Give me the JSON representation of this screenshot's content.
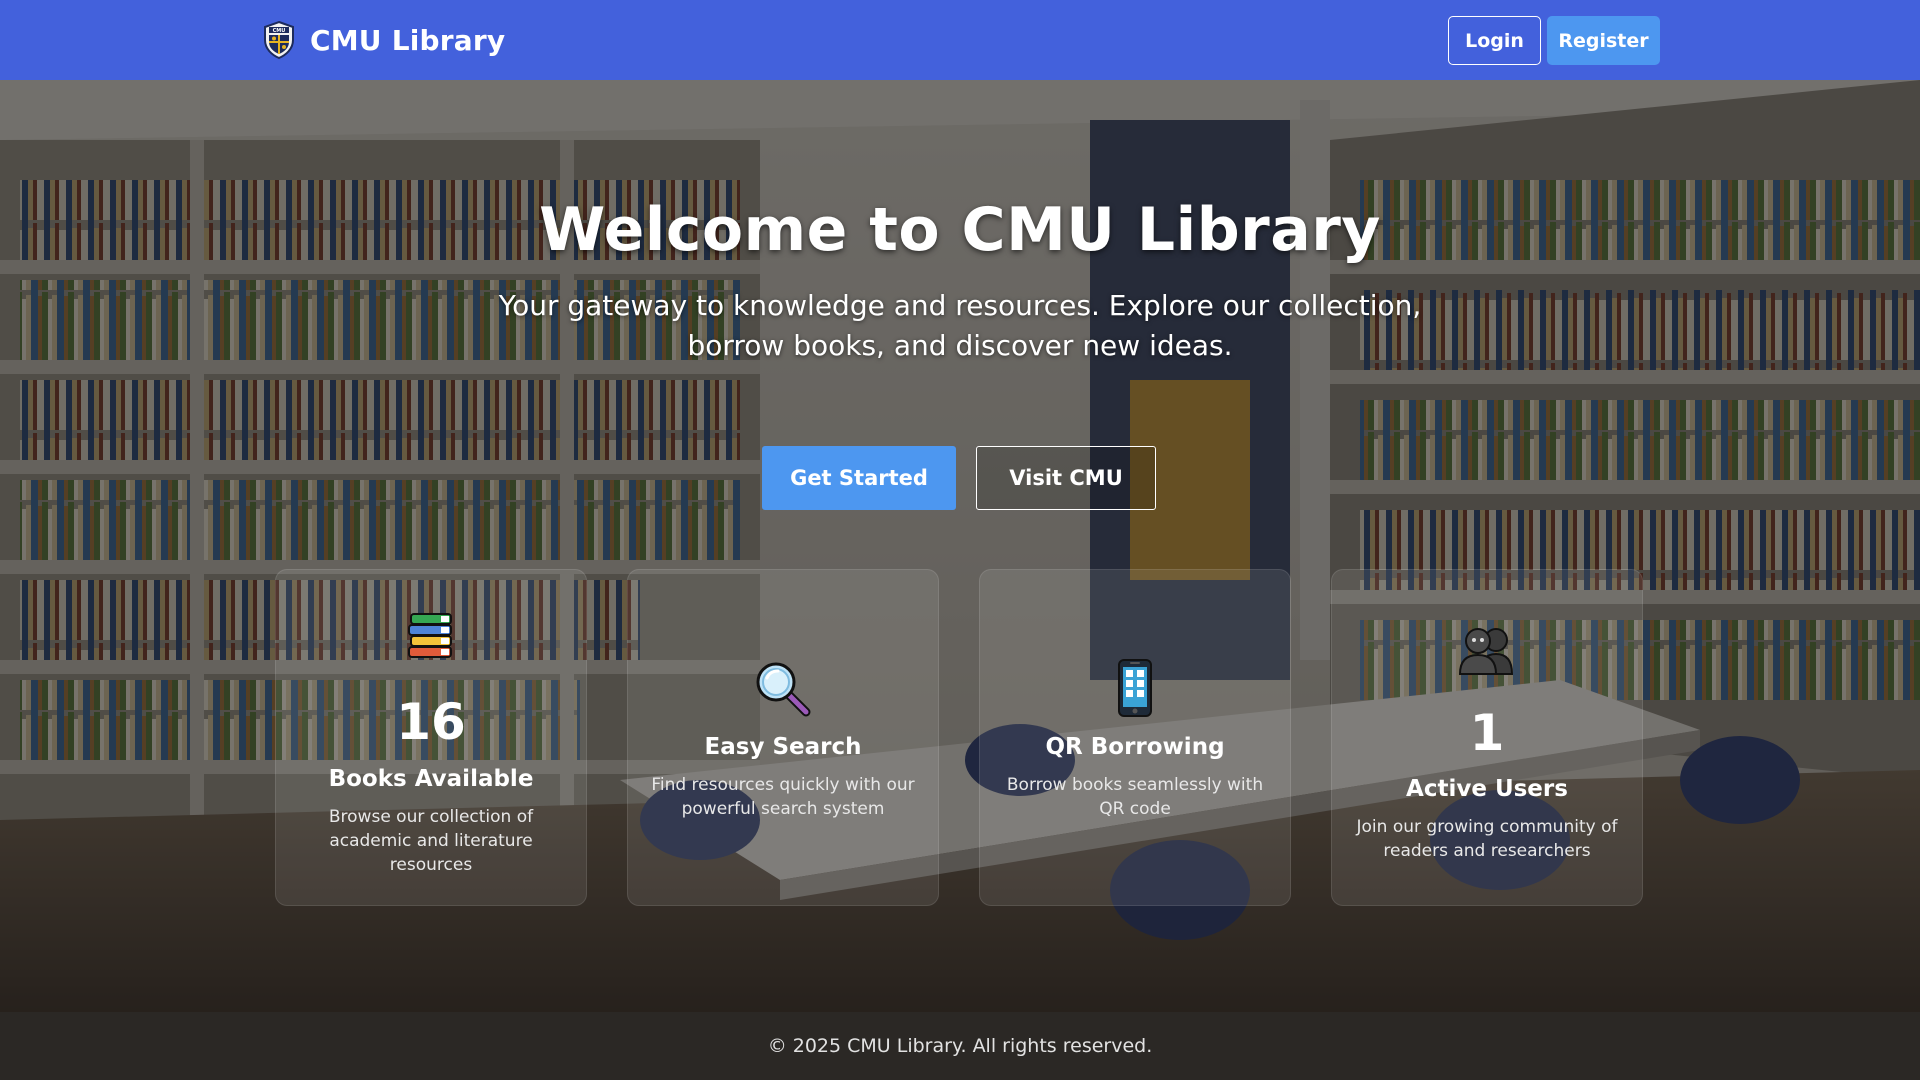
{
  "navbar": {
    "brand_name": "CMU Library",
    "brand_logo_text": "CMU",
    "login_label": "Login",
    "register_label": "Register",
    "background_color": "#4361dc"
  },
  "hero": {
    "title": "Welcome to CMU Library",
    "subtitle": "Your gateway to knowledge and resources. Explore our collection, borrow books, and discover new ideas.",
    "get_started_label": "Get Started",
    "visit_cmu_label": "Visit CMU",
    "background_image": "library-bookshelves-photo"
  },
  "cards": [
    {
      "icon": "books-stack-icon",
      "stat": "16",
      "title": "Books Available",
      "description": "Browse our collection of academic and literature resources"
    },
    {
      "icon": "magnifying-glass-icon",
      "title": "Easy Search",
      "description": "Find resources quickly with our powerful search system"
    },
    {
      "icon": "mobile-phone-icon",
      "title": "QR Borrowing",
      "description": "Borrow books seamlessly with QR code"
    },
    {
      "icon": "users-group-icon",
      "stat": "1",
      "title": "Active Users",
      "description": "Join our growing community of readers and researchers"
    }
  ],
  "footer": {
    "copyright": "© 2025 CMU Library. All rights reserved."
  },
  "colors": {
    "primary": "#4361dc",
    "accent_button": "#4d97f0",
    "footer": "#2b2825"
  }
}
